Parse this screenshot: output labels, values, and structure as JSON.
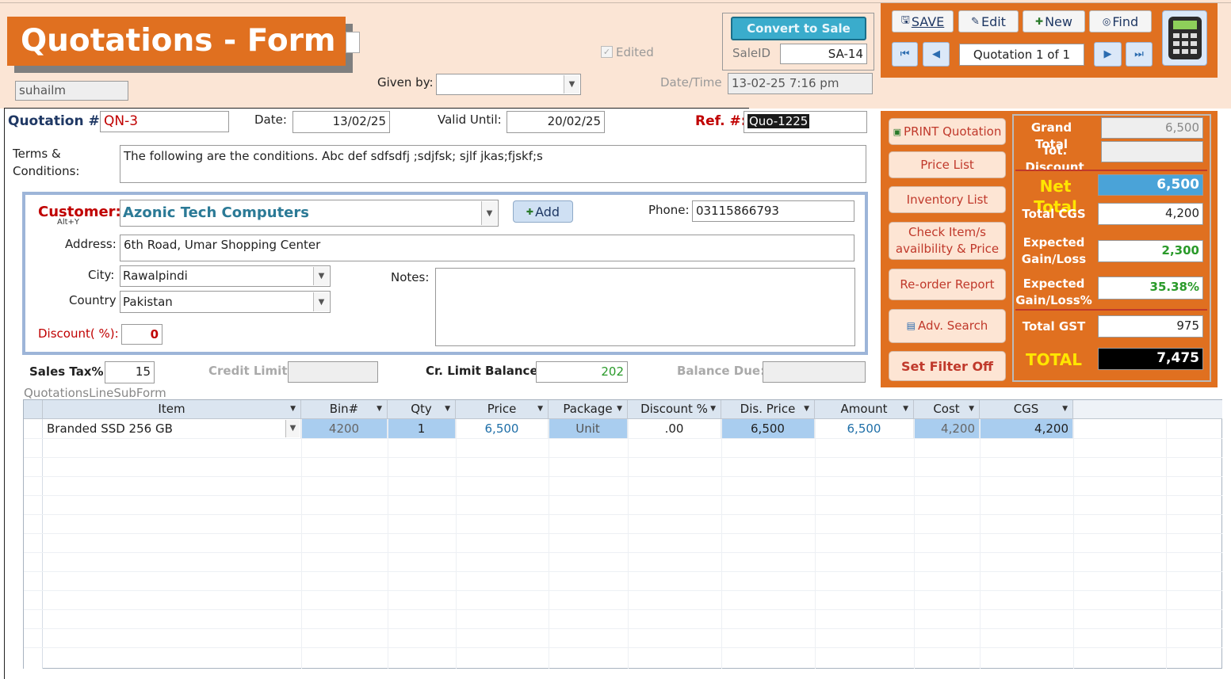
{
  "header": {
    "title": "Quotations - Form",
    "user": "suhailm",
    "given_by_label": "Given by:",
    "given_by_value": "",
    "edited_label": "Edited",
    "convert_button": "Convert to Sale",
    "saleid_label": "SaleID",
    "saleid_value": "SA-14",
    "datetime_label": "Date/Time",
    "datetime_value": "13-02-25  7:16 pm"
  },
  "toolbar": {
    "save": "SAVE",
    "edit": "Edit",
    "new": "New",
    "find": "Find",
    "record_nav": "Quotation 1 of 1"
  },
  "quote": {
    "number_label": "Quotation #:",
    "number": "QN-3",
    "date_label": "Date:",
    "date": "13/02/25",
    "valid_label": "Valid Until:",
    "valid": "20/02/25",
    "ref_label": "Ref. #:",
    "ref": "Quo-1225",
    "terms_label_1": "Terms &",
    "terms_label_2": "Conditions:",
    "terms": "The following are the conditions. Abc def sdfsdfj ;sdjfsk; sjlf jkas;fjskf;s"
  },
  "customer": {
    "label": "Customer:",
    "hint": "Alt+Y",
    "name": "Azonic Tech Computers",
    "add_button": "Add",
    "phone_label": "Phone:",
    "phone": "03115866793",
    "address_label": "Address:",
    "address": "6th Road, Umar Shopping Center",
    "city_label": "City:",
    "city": "Rawalpindi",
    "country_label": "Country",
    "country": "Pakistan",
    "notes_label": "Notes:",
    "notes": "",
    "discount_label": "Discount( %):",
    "discount": "0"
  },
  "tax": {
    "sales_tax_label": "Sales Tax%:",
    "sales_tax": "15",
    "credit_limit_label": "Credit Limit:",
    "credit_limit": "",
    "cr_balance_label": "Cr. Limit Balance:",
    "cr_balance": "202",
    "balance_due_label": "Balance Due:",
    "balance_due": ""
  },
  "actions": {
    "print": "PRINT Quotation",
    "price_list": "Price List",
    "inventory": "Inventory List",
    "check_1": "Check Item/s",
    "check_2": "availbility & Price",
    "reorder": "Re-order Report",
    "adv_search": "Adv. Search",
    "filter_off": "Set Filter Off"
  },
  "summary": {
    "grand_total_label": "Grand Total",
    "grand_total": "6,500",
    "tot_discount_label": "Tot. Discount",
    "tot_discount": "",
    "net_total_label": "Net Total",
    "net_total": "6,500",
    "total_cgs_label": "Total CGS",
    "total_cgs": "4,200",
    "exp_gain_label_1": "Expected",
    "exp_gain_label_2": "Gain/Loss",
    "exp_gain": "2,300",
    "exp_gain_pct_label_1": "Expected",
    "exp_gain_pct_label_2": "Gain/Loss%",
    "exp_gain_pct": "35.38%",
    "total_gst_label": "Total GST",
    "total_gst": "975",
    "total_label": "TOTAL",
    "total": "7,475"
  },
  "subform": {
    "caption": "QuotationsLineSubForm",
    "columns": [
      "Item",
      "Bin#",
      "Qty",
      "Price",
      "Package",
      "Discount %",
      "Dis. Price",
      "Amount",
      "Cost",
      "CGS"
    ],
    "row": {
      "item": "Branded SSD 256 GB",
      "bin": "4200",
      "qty": "1",
      "price": "6,500",
      "package": "Unit",
      "discount": ".00",
      "dis_price": "6,500",
      "amount": "6,500",
      "cost": "4,200",
      "cgs": "4,200"
    }
  },
  "colors": {
    "accent": "#e07020",
    "header_bg": "#fbe5d5",
    "teal": "#3aaccc",
    "grid_blue": "#a9cdef"
  }
}
